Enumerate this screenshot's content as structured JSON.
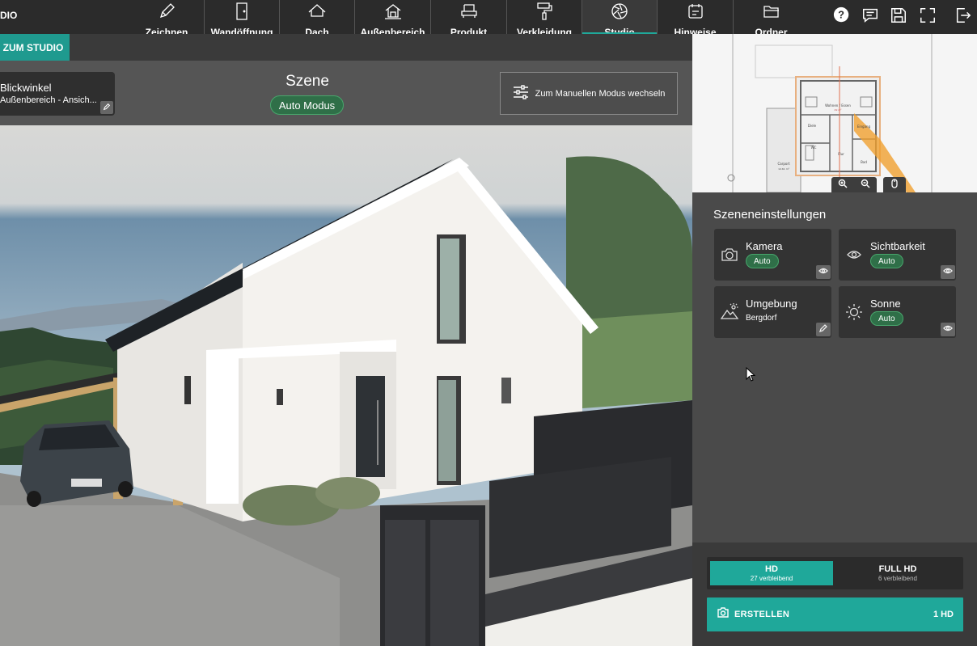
{
  "app": {
    "name_fragment": "DIO"
  },
  "nav": [
    {
      "label": "Zeichnen",
      "icon": "pencil-icon"
    },
    {
      "label": "Wandöffnung",
      "icon": "door-icon"
    },
    {
      "label": "Dach",
      "icon": "roof-icon"
    },
    {
      "label": "Außenbereich",
      "icon": "garden-house-icon"
    },
    {
      "label": "Produkt",
      "icon": "armchair-icon"
    },
    {
      "label": "Verkleidung",
      "icon": "paint-roller-icon"
    },
    {
      "label": "Studio",
      "icon": "camera-aperture-icon",
      "active": true
    },
    {
      "label": "Hinweise",
      "icon": "notes-icon"
    },
    {
      "label": "Ordner",
      "icon": "folder-icon"
    }
  ],
  "toolbar_icons": [
    "help-icon",
    "comment-icon",
    "save-icon",
    "fullscreen-icon",
    "logout-icon"
  ],
  "tab": {
    "label": "ZUM STUDIO"
  },
  "view": {
    "title": "Blickwinkel",
    "subtitle": "Außenbereich - Ansich..."
  },
  "scene": {
    "title": "Szene",
    "mode": "Auto Modus",
    "manual_button": "Zum Manuellen Modus wechseln"
  },
  "settings": {
    "title": "Szeneneinstellungen",
    "cards": [
      {
        "name": "Kamera",
        "value": "Auto",
        "icon": "camera-icon",
        "action_icon": "eye-icon"
      },
      {
        "name": "Sichtbarkeit",
        "value": "Auto",
        "icon": "eye-icon",
        "action_icon": "eye-icon"
      },
      {
        "name": "Umgebung",
        "value": "Bergdorf",
        "icon": "landscape-icon",
        "action_icon": "pencil-icon"
      },
      {
        "name": "Sonne",
        "value": "Auto",
        "icon": "sun-icon",
        "action_icon": "eye-icon"
      }
    ]
  },
  "minimap": {
    "rooms": [
      "Wohnen / Essen",
      "Diele",
      "WC",
      "Flur",
      "Bad",
      "Eingang",
      "Carport"
    ],
    "areas": [
      "49 m²",
      "12.61 m²"
    ]
  },
  "quality": {
    "options": [
      {
        "label": "HD",
        "remaining": "27 verbleibend",
        "selected": true
      },
      {
        "label": "FULL HD",
        "remaining": "6 verbleibend",
        "selected": false
      }
    ]
  },
  "create": {
    "label": "ERSTELLEN",
    "cost": "1 HD"
  },
  "colors": {
    "accent": "#1fa89a",
    "topbar": "#2b2b2b",
    "pill_green": "#2f6f48"
  }
}
